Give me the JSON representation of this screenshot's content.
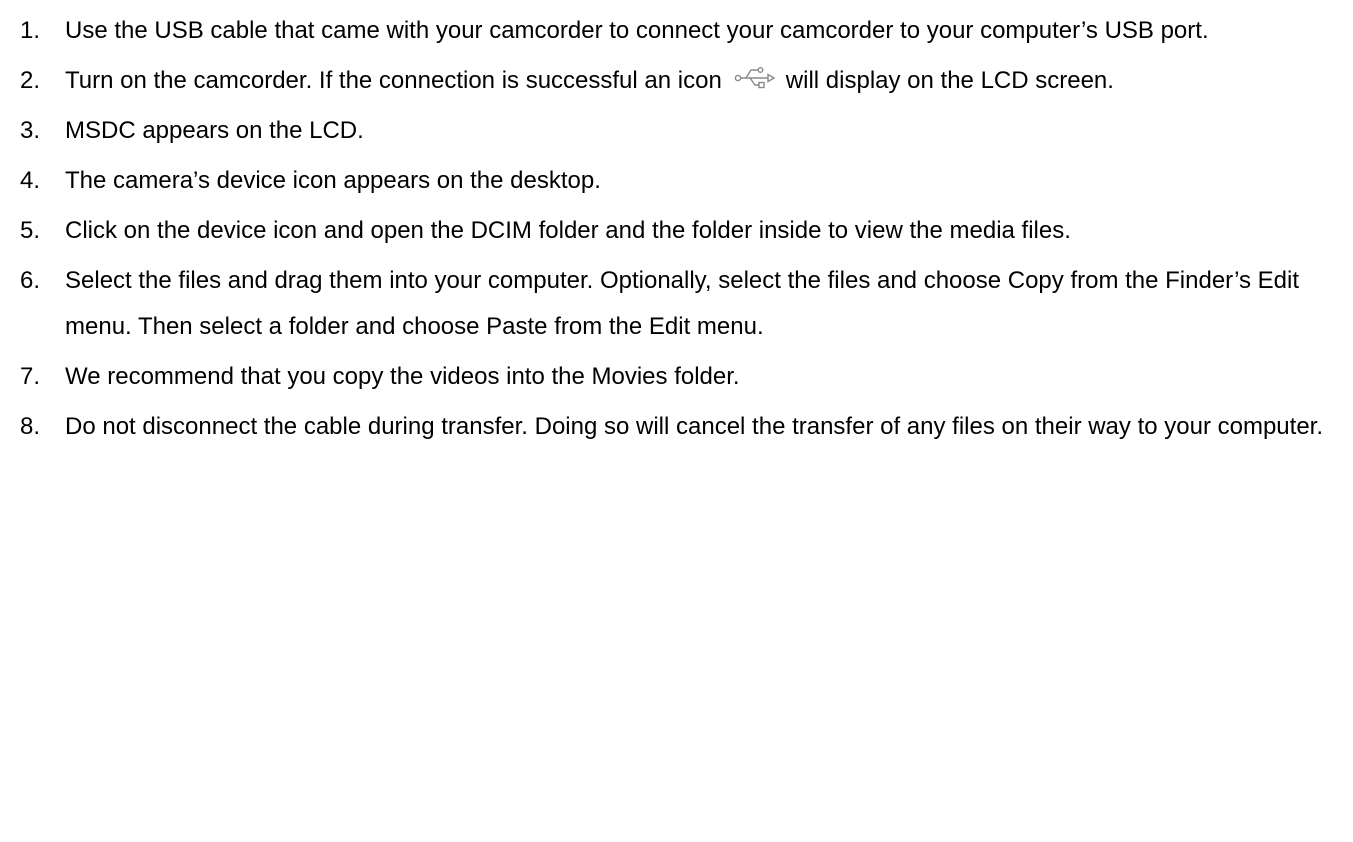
{
  "steps": [
    {
      "num": "1.",
      "text": "Use the USB cable that came with your camcorder to connect your camcorder to your computer’s USB port."
    },
    {
      "num": "2.",
      "text_before_icon": "Turn on the camcorder. If the connection is successful an icon",
      "icon": "usb-icon",
      "text_after_icon": "will display on the LCD screen."
    },
    {
      "num": "3.",
      "text": "MSDC appears on the LCD."
    },
    {
      "num": "4.",
      "text": "The camera’s device icon appears on the desktop."
    },
    {
      "num": "5.",
      "text": "Click on the device icon and open the DCIM folder and the folder inside to view the media files."
    },
    {
      "num": "6.",
      "text": "Select the files and drag them into your computer. Optionally, select the files and choose Copy from the Finder’s Edit menu. Then select a folder and choose Paste from the Edit menu."
    },
    {
      "num": "7.",
      "text": "We recommend that you copy the videos into the Movies folder."
    },
    {
      "num": "8.",
      "text": "Do not disconnect the cable during transfer. Doing so will cancel the transfer of any files on their way to your computer."
    }
  ]
}
